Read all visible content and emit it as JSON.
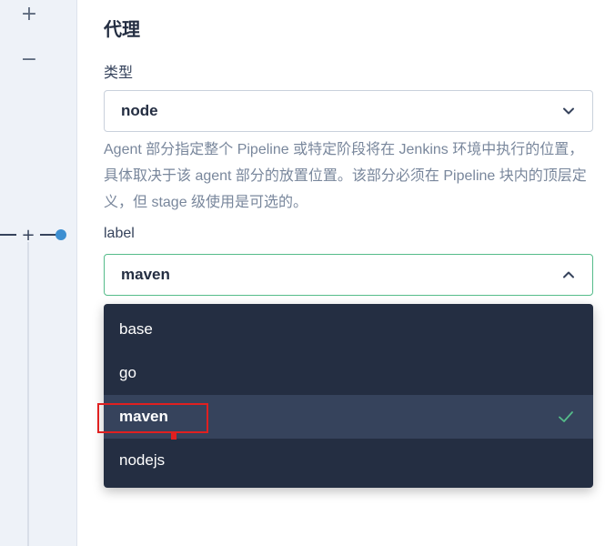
{
  "canvas": {
    "zoom_in_icon": "+",
    "zoom_out_icon": "−",
    "add_node_icon": "+"
  },
  "panel": {
    "title": "代理",
    "type_label": "类型",
    "type_value": "node",
    "help_text": "Agent 部分指定整个 Pipeline 或特定阶段将在 Jenkins 环境中执行的位置， 具体取决于该 agent 部分的放置位置。该部分必须在 Pipeline 块内的顶层定义，但 stage 级使用是可选的。",
    "label_label": "label",
    "label_value": "maven",
    "options": [
      {
        "label": "base"
      },
      {
        "label": "go"
      },
      {
        "label": "maven",
        "selected": true
      },
      {
        "label": "nodejs"
      }
    ]
  },
  "colors": {
    "accent_green": "#55bc8a",
    "dropdown_bg": "#242e42",
    "dropdown_selected_bg": "#36435c",
    "highlight_red": "#e02020",
    "node_blue": "#3d8fd1"
  }
}
